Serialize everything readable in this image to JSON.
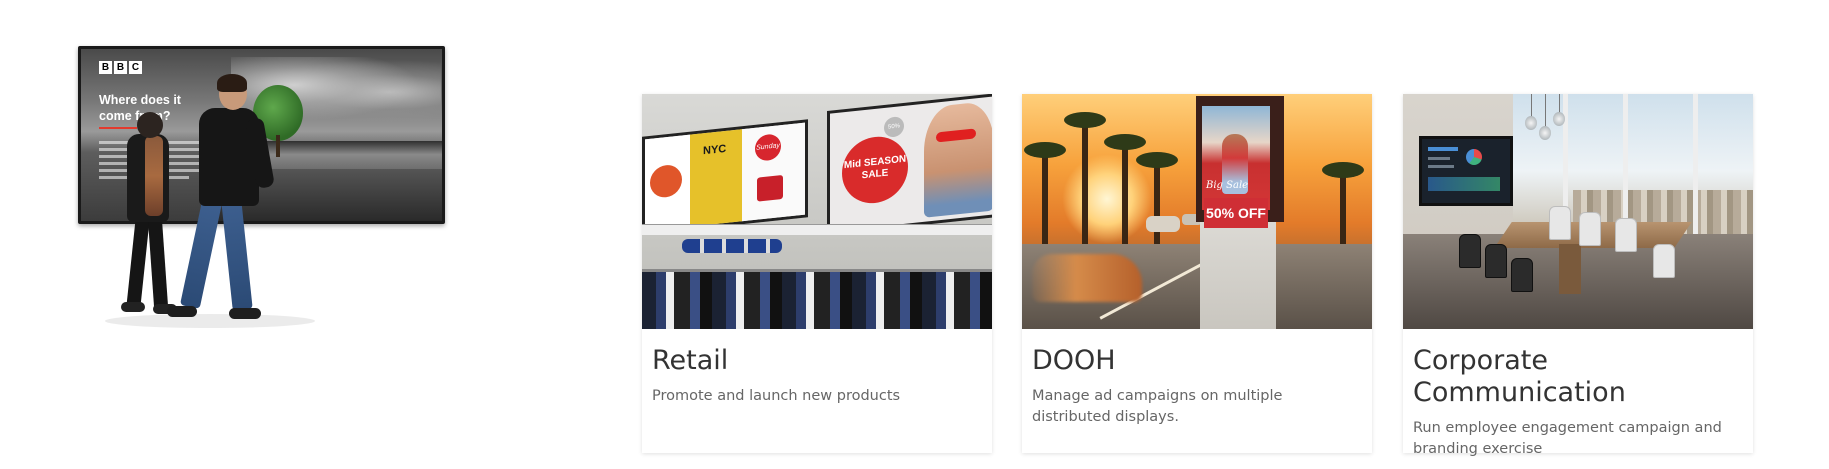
{
  "hero": {
    "tv_brand": [
      "B",
      "B",
      "C"
    ],
    "tv_headline": "Where does it come from?"
  },
  "cards": [
    {
      "title": "Retail",
      "description": "Promote and launch new products",
      "image": {
        "screen1_brand": "NYC",
        "screen1_badge": "Sunday",
        "sale_text": "Mid SEASON SALE",
        "sale_badge": "50%"
      }
    },
    {
      "title": "DOOH",
      "description": "Manage ad campaigns on multiple distributed displays.",
      "image": {
        "screen_script": "Big Sale",
        "screen_offer": "50% OFF"
      }
    },
    {
      "title": "Corporate Communication",
      "description": "Run employee engagement campaign and branding exercise",
      "image": {}
    }
  ],
  "colors": {
    "title": "#333333",
    "description": "#666666",
    "sale_red": "#d92b2b"
  }
}
